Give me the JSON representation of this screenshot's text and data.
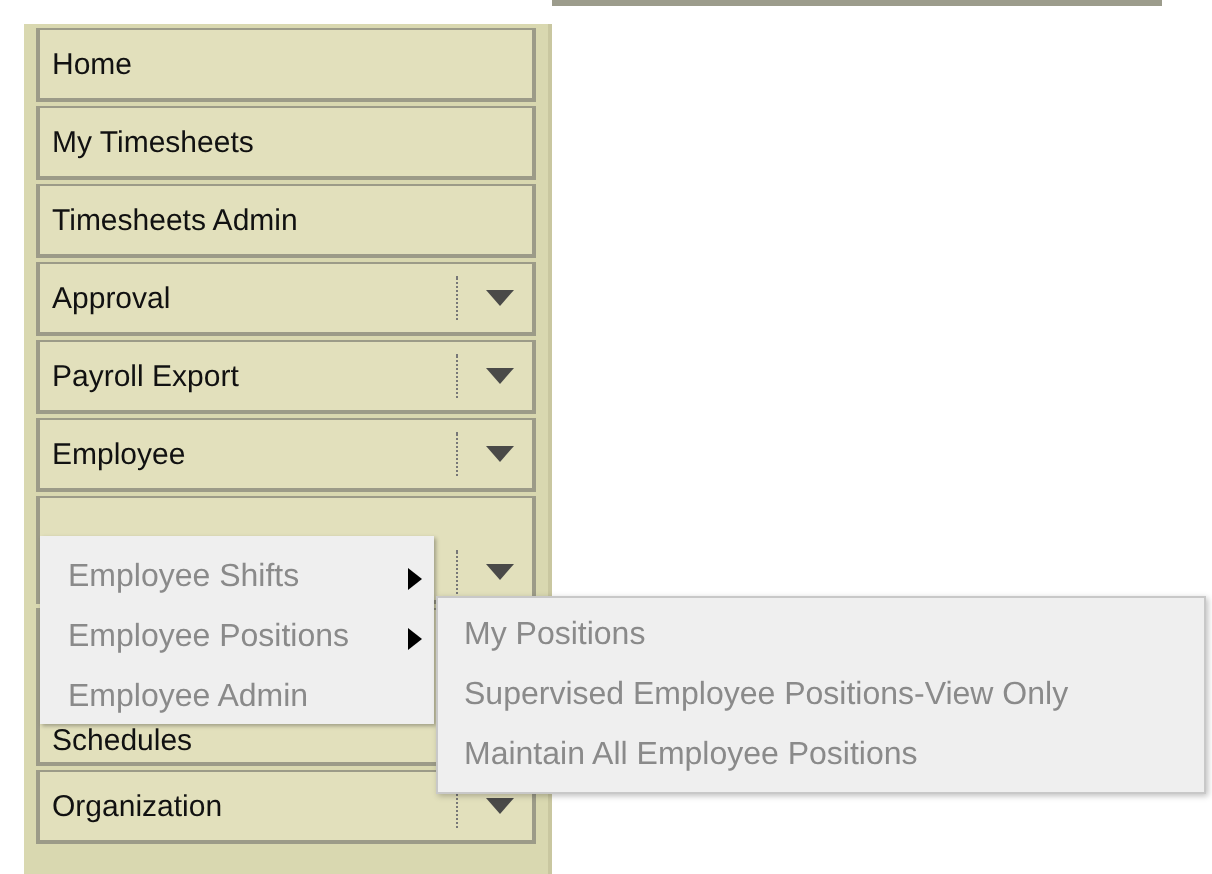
{
  "sidebar": {
    "items": [
      {
        "kind": "link",
        "label": "Home"
      },
      {
        "kind": "link",
        "label": "My Timesheets"
      },
      {
        "kind": "link",
        "label": "Timesheets Admin"
      },
      {
        "kind": "menu",
        "label": "Approval"
      },
      {
        "kind": "menu",
        "label": "Payroll Export"
      },
      {
        "kind": "menu",
        "label": "Employee"
      },
      {
        "kind": "covered-menu"
      },
      {
        "kind": "covered-link",
        "label": "Schedules"
      },
      {
        "kind": "menu",
        "label": "Organization"
      }
    ]
  },
  "employee_menu": {
    "items": [
      {
        "label": "Employee Shifts",
        "has_submenu": true
      },
      {
        "label": "Employee Positions",
        "has_submenu": true,
        "submenu": [
          {
            "label": "My Positions"
          },
          {
            "label": "Supervised Employee Positions-View Only"
          },
          {
            "label": "Maintain All Employee Positions"
          }
        ]
      },
      {
        "label": "Employee Admin",
        "has_submenu": false
      }
    ]
  }
}
